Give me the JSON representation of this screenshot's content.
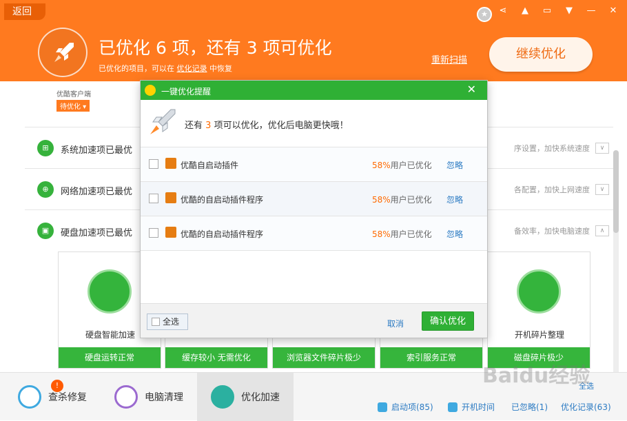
{
  "header": {
    "back_label": "返回",
    "title": "已优化 6 项，还有 3 项可优化",
    "subtitle_prefix": "已优化的项目，可以在",
    "subtitle_link": "优化记录",
    "subtitle_suffix": "中恢复",
    "rescan_label": "重新扫描",
    "continue_label": "继续优化"
  },
  "window_controls": [
    "share",
    "skin",
    "feedback",
    "menu",
    "minimize",
    "close"
  ],
  "pending": {
    "label": "优酷客户端",
    "tag": "待优化"
  },
  "sections": [
    {
      "title": "系统加速项已最优",
      "desc": "序设置，加快系统速度",
      "icon": "windows-icon"
    },
    {
      "title": "网络加速项已最优",
      "desc": "各配置，加快上网速度",
      "icon": "network-icon"
    },
    {
      "title": "硬盘加速项已最优",
      "desc": "备效率，加快电脑速度",
      "icon": "disk-icon"
    }
  ],
  "cards": [
    {
      "title": "硬盘智能加速",
      "status": "硬盘运转正常"
    },
    {
      "title": "",
      "status": "缓存较小 无需优化"
    },
    {
      "title": "",
      "status": "浏览器文件碎片极少"
    },
    {
      "title": "",
      "status": "索引服务正常"
    },
    {
      "title": "开机碎片整理",
      "status": "磁盘碎片极少"
    }
  ],
  "dialog": {
    "title": "一键优化提醒",
    "msg_prefix": "还有",
    "msg_count": "3",
    "msg_suffix": "项可以优化，优化后电脑更快哦！",
    "items": [
      {
        "name": "优酷自启动插件",
        "pct": "58%",
        "pct_suffix": "用户已优化",
        "ignore": "忽略"
      },
      {
        "name": "优酷的自启动插件程序",
        "pct": "58%",
        "pct_suffix": "用户已优化",
        "ignore": "忽略"
      },
      {
        "name": "优酷的自启动插件程序",
        "pct": "58%",
        "pct_suffix": "用户已优化",
        "ignore": "忽略"
      }
    ],
    "select_all": "全选",
    "cancel": "取消",
    "confirm": "确认优化"
  },
  "bottom_nav": [
    {
      "label": "查杀修复",
      "badge": "!"
    },
    {
      "label": "电脑清理"
    },
    {
      "label": "优化加速"
    }
  ],
  "bottom_stats": [
    {
      "label": "启动项(85)"
    },
    {
      "label": "开机时间"
    },
    {
      "label": "已忽略(1)"
    },
    {
      "label": "优化记录(63)"
    }
  ],
  "bottom_select_all": "全选",
  "watermark": "Baidu经验",
  "colors": {
    "header": "#ff7a1f",
    "green": "#2fb035",
    "link": "#2c7bc3",
    "highlight": "#ff6a00"
  }
}
